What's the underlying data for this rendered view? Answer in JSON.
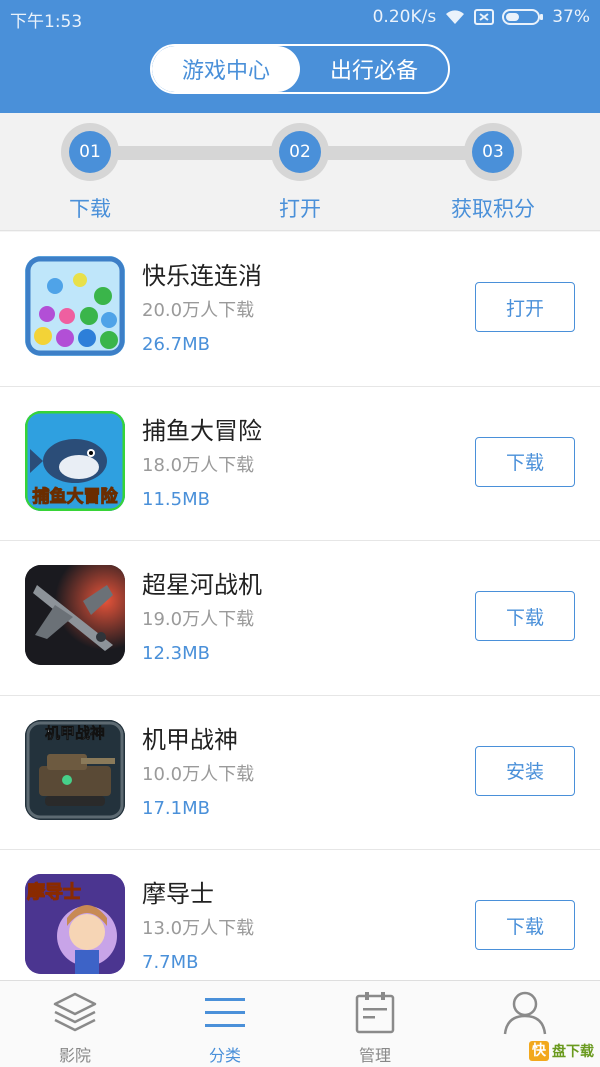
{
  "status_bar": {
    "time": "下午1:53",
    "speed": "0.20K/s",
    "battery": "37%"
  },
  "tabs": [
    {
      "label": "游戏中心",
      "active": true
    },
    {
      "label": "出行必备",
      "active": false
    }
  ],
  "steps": [
    {
      "num": "01",
      "label": "下载"
    },
    {
      "num": "02",
      "label": "打开"
    },
    {
      "num": "03",
      "label": "获取积分"
    }
  ],
  "apps": [
    {
      "name": "快乐连连消",
      "downloads": "20.0万人下载",
      "size": "26.7MB",
      "action": "打开"
    },
    {
      "name": "捕鱼大冒险",
      "downloads": "18.0万人下载",
      "size": "11.5MB",
      "action": "下载",
      "icon_text": "捕鱼大冒险"
    },
    {
      "name": "超星河战机",
      "downloads": "19.0万人下载",
      "size": "12.3MB",
      "action": "下载"
    },
    {
      "name": "机甲战神",
      "downloads": "10.0万人下载",
      "size": "17.1MB",
      "action": "安装",
      "icon_text": "机甲战神"
    },
    {
      "name": "摩导士",
      "downloads": "13.0万人下载",
      "size": "7.7MB",
      "action": "下载",
      "icon_text": "摩导士"
    }
  ],
  "bottom_nav": [
    {
      "label": "影院",
      "icon": "layers-icon",
      "active": false
    },
    {
      "label": "分类",
      "icon": "menu-icon",
      "active": true
    },
    {
      "label": "管理",
      "icon": "clipboard-icon",
      "active": false
    },
    {
      "label": "",
      "icon": "user-icon",
      "active": false
    }
  ],
  "watermark": {
    "brand": "快",
    "text": "盘下载"
  },
  "colors": {
    "accent": "#4a90d9",
    "header": "#4a90d9",
    "text": "#222222",
    "muted": "#9a9a9a"
  }
}
